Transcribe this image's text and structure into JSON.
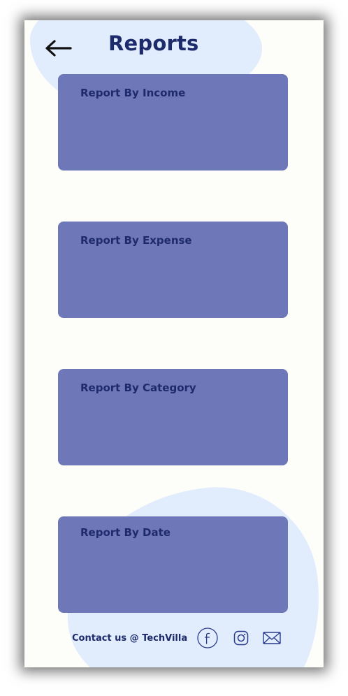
{
  "header": {
    "title": "Reports",
    "back_icon": "arrow-left-icon"
  },
  "reports": [
    {
      "label": "Report By Income"
    },
    {
      "label": "Report By Expense"
    },
    {
      "label": "Report By Category"
    },
    {
      "label": "Report By Date"
    }
  ],
  "footer": {
    "contact_prefix": "Contact us @",
    "brand": "TechVilla",
    "icons": [
      "facebook-icon",
      "instagram-icon",
      "mail-icon"
    ]
  },
  "colors": {
    "primary_text": "#1d2a6b",
    "card": "#6e78b9",
    "blob": "#e1edfc",
    "background": "#fdfdf9"
  }
}
